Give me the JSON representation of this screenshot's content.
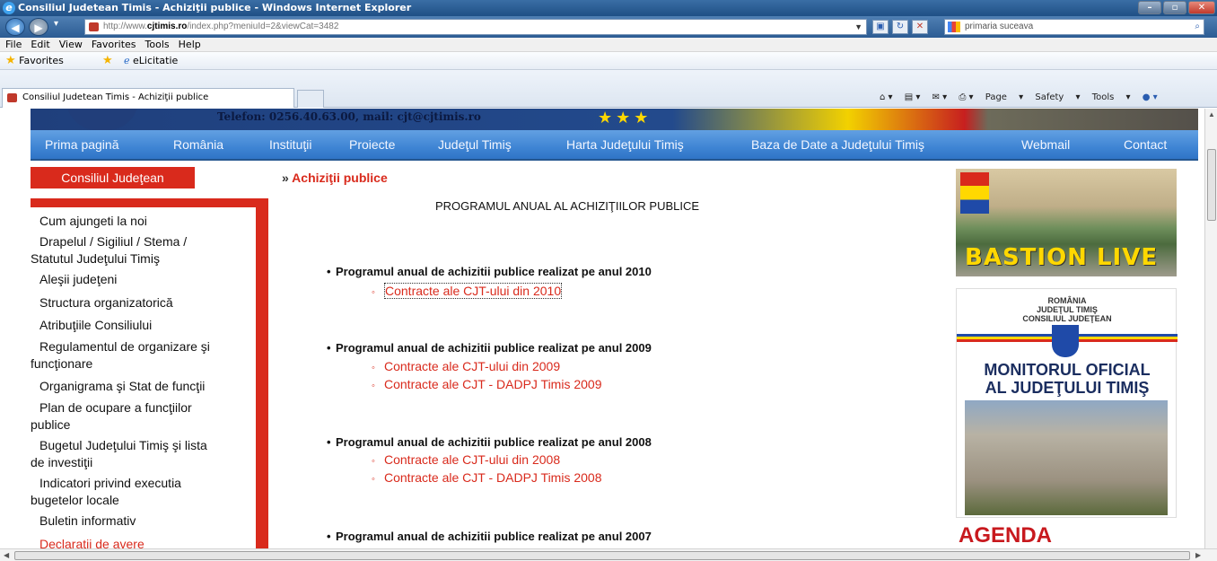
{
  "window": {
    "title": "Consiliul Judetean Timis - Achiziţii publice - Windows Internet Explorer"
  },
  "address_bar": {
    "url_prefix": "http://www.",
    "url_domain": "cjtimis.ro",
    "url_rest": "/index.php?meniuId=2&viewCat=3482",
    "search_value": "primaria suceava"
  },
  "menu": [
    "File",
    "Edit",
    "View",
    "Favorites",
    "Tools",
    "Help"
  ],
  "favorites_bar": {
    "favorites_label": "Favorites",
    "link": "eLicitatie"
  },
  "tab": {
    "label": "Consiliul Judetean Timis - Achiziţii publice"
  },
  "command_bar": {
    "page": "Page",
    "safety": "Safety",
    "tools": "Tools"
  },
  "site": {
    "banner_text": "Telefon: 0256.40.63.00, mail: cjt@cjtimis.ro",
    "nav": [
      "Prima pagină",
      "România",
      "Instituţii",
      "Proiecte",
      "Judeţul Timiş",
      "Harta Judeţului Timiş",
      "Baza de Date a Judeţului Timiş",
      "Webmail",
      "Contact"
    ]
  },
  "sidebar": {
    "heading": "Consiliul Judeţean",
    "items": [
      {
        "line1": "Cum ajungeti la noi",
        "line2": ""
      },
      {
        "line1": "Drapelul / Sigiliul / Stema /",
        "line2": "Statutul Judeţului Timiş"
      },
      {
        "line1": "Aleşii judeţeni",
        "line2": ""
      },
      {
        "line1": "Structura organizatorică",
        "line2": ""
      },
      {
        "line1": "Atribuţiile Consiliului",
        "line2": ""
      },
      {
        "line1": "Regulamentul de organizare şi",
        "line2": "funcţionare"
      },
      {
        "line1": "Organigrama şi Stat de funcţii",
        "line2": ""
      },
      {
        "line1": "Plan de ocupare a funcţiilor",
        "line2": "publice"
      },
      {
        "line1": "Bugetul Judeţului Timiş şi lista",
        "line2": "de investiţii"
      },
      {
        "line1": "Indicatori privind executia",
        "line2": "bugetelor locale"
      },
      {
        "line1": "Buletin informativ",
        "line2": ""
      },
      {
        "line1": "Declaratii de avere",
        "line2": ""
      }
    ]
  },
  "main": {
    "breadcrumb_prefix": "»",
    "breadcrumb": "Achiziţii publice",
    "page_title": "PROGRAMUL ANUAL AL ACHIZIŢIILOR PUBLICE",
    "programs": [
      {
        "title": "Programul anual de achizitii publice realizat pe anul 2010",
        "links": [
          "Contracte ale CJT-ului din 2010"
        ]
      },
      {
        "title": "Programul anual de achizitii publice realizat pe anul 2009",
        "links": [
          "Contracte ale CJT-ului din 2009",
          "Contracte ale CJT - DADPJ Timis 2009"
        ]
      },
      {
        "title": "Programul anual de achizitii publice realizat pe anul 2008",
        "links": [
          "Contracte ale CJT-ului din 2008",
          "Contracte ale CJT - DADPJ Timis 2008"
        ]
      },
      {
        "title": "Programul anual de achizitii publice realizat pe anul 2007",
        "links": []
      }
    ]
  },
  "right_column": {
    "bastion": "BASTION LIVE",
    "monitor_header": [
      "ROMÂNIA",
      "JUDEŢUL TIMIŞ",
      "CONSILIUL JUDEŢEAN"
    ],
    "monitor_title": [
      "MONITORUL OFICIAL",
      "AL JUDEŢULUI TIMIŞ"
    ],
    "agenda": "AGENDA"
  },
  "colors": {
    "accent_red": "#d92a1c",
    "nav_blue": "#3f85d4",
    "bastion_yellow": "#ffd800"
  }
}
